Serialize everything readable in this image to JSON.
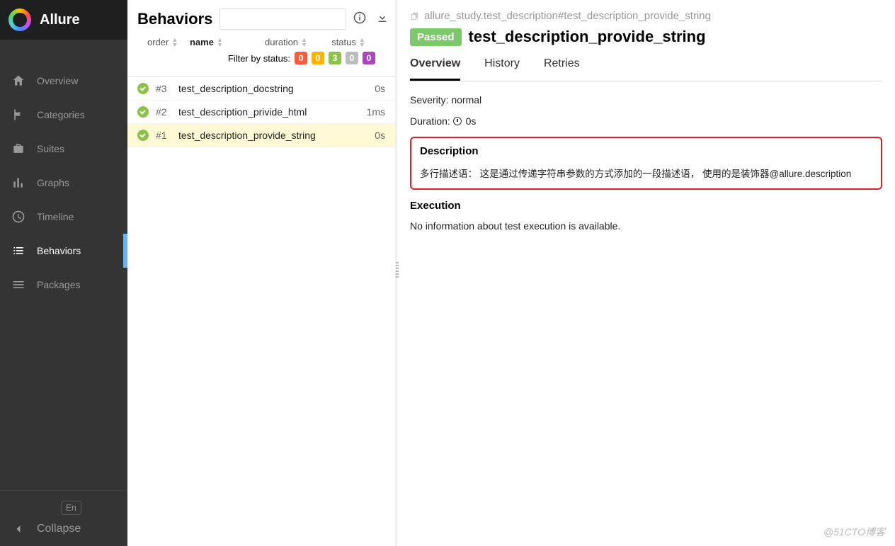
{
  "brand": "Allure",
  "sidebar": {
    "items": [
      {
        "label": "Overview"
      },
      {
        "label": "Categories"
      },
      {
        "label": "Suites"
      },
      {
        "label": "Graphs"
      },
      {
        "label": "Timeline"
      },
      {
        "label": "Behaviors"
      },
      {
        "label": "Packages"
      }
    ],
    "lang": "En",
    "collapse": "Collapse"
  },
  "middle": {
    "title": "Behaviors",
    "columns": {
      "order": "order",
      "name": "name",
      "duration": "duration",
      "status": "status"
    },
    "filter_label": "Filter by status:",
    "badges": [
      "0",
      "0",
      "3",
      "0",
      "0"
    ],
    "tests": [
      {
        "id": "#3",
        "name": "test_description_docstring",
        "dur": "0s"
      },
      {
        "id": "#2",
        "name": "test_description_privide_html",
        "dur": "1ms"
      },
      {
        "id": "#1",
        "name": "test_description_provide_string",
        "dur": "0s"
      }
    ]
  },
  "detail": {
    "breadcrumb": "allure_study.test_description#test_description_provide_string",
    "status": "Passed",
    "title": "test_description_provide_string",
    "tabs": [
      "Overview",
      "History",
      "Retries"
    ],
    "severity_label": "Severity: ",
    "severity_value": "normal",
    "duration_label": "Duration: ",
    "duration_value": "0s",
    "desc_h": "Description",
    "desc_body": "多行描述语：  这是通过传递字符串参数的方式添加的一段描述语，  使用的是装饰器@allure.description",
    "exec_h": "Execution",
    "exec_body": "No information about test execution is available."
  },
  "watermark": "@51CTO博客"
}
